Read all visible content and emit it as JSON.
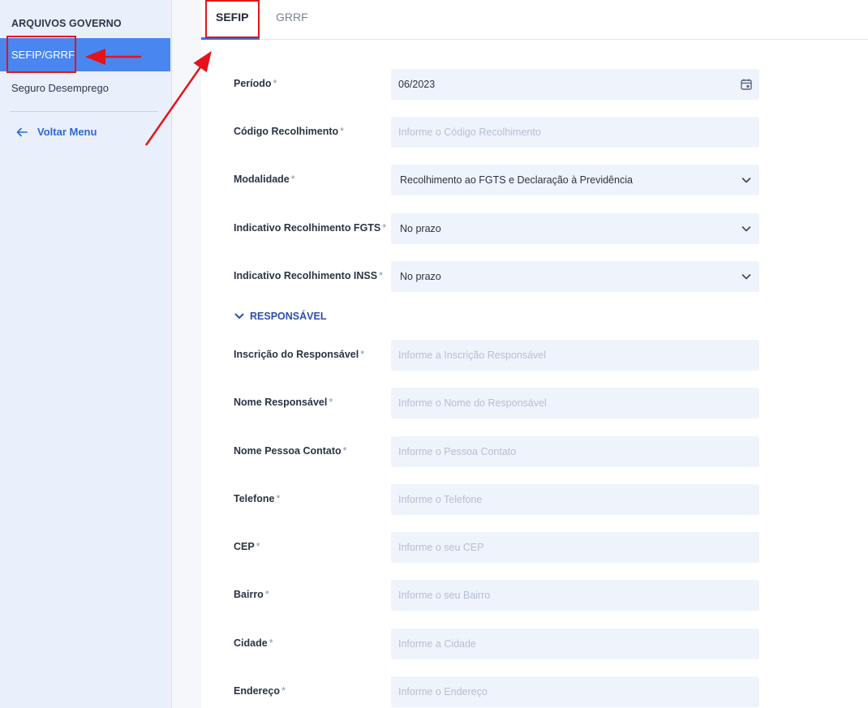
{
  "sidebar": {
    "section_title": "ARQUIVOS GOVERNO",
    "items": [
      {
        "label": "SEFIP/GRRF",
        "active": true
      },
      {
        "label": "Seguro Desemprego",
        "active": false
      }
    ],
    "back_label": "Voltar Menu",
    "back_icon": "arrow-left-icon"
  },
  "tabs": [
    {
      "label": "SEFIP",
      "active": true
    },
    {
      "label": "GRRF",
      "active": false
    }
  ],
  "form": {
    "required_mark": "*",
    "periodo": {
      "label": "Período",
      "value": "06/2023",
      "icon": "calendar-icon"
    },
    "codigo": {
      "label": "Código Recolhimento",
      "placeholder": "Informe o Código Recolhimento"
    },
    "modalidade": {
      "label": "Modalidade",
      "value": "Recolhimento ao FGTS e Declaração à Previdência"
    },
    "ind_fgts": {
      "label": "Indicativo Recolhimento FGTS",
      "value": "No prazo"
    },
    "ind_inss": {
      "label": "Indicativo Recolhimento INSS",
      "value": "No prazo"
    },
    "section_responsavel": "RESPONSÁVEL",
    "inscricao": {
      "label": "Inscrição do Responsável",
      "placeholder": "Informe a Inscrição Responsável"
    },
    "nome_resp": {
      "label": "Nome Responsável",
      "placeholder": "Informe o Nome do Responsável"
    },
    "nome_contato": {
      "label": "Nome Pessoa Contato",
      "placeholder": "Informe o Pessoa Contato"
    },
    "telefone": {
      "label": "Telefone",
      "placeholder": "Informe o Telefone"
    },
    "cep": {
      "label": "CEP",
      "placeholder": "Informe o seu CEP"
    },
    "bairro": {
      "label": "Bairro",
      "placeholder": "Informe o seu Bairro"
    },
    "cidade": {
      "label": "Cidade",
      "placeholder": "Informe a Cidade"
    },
    "endereco": {
      "label": "Endereço",
      "placeholder": "Informe o Endereço"
    }
  },
  "colors": {
    "accent": "#4a86f0",
    "annotation": "#e3141b",
    "field_bg": "#eef3fc"
  }
}
